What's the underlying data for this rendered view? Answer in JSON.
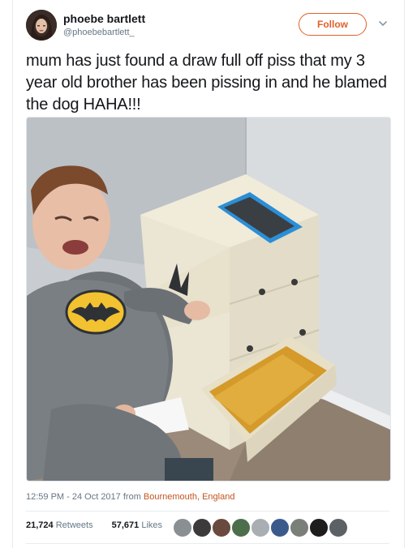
{
  "tweet": {
    "user": {
      "display_name": "phoebe bartlett",
      "handle": "@phoebebartlett_",
      "avatar_icon": "profile-avatar"
    },
    "follow_label": "Follow",
    "more_icon": "chevron-down-icon",
    "text": "mum has just found a draw full off piss that my 3 year old brother has been pissing in and he blamed the dog HAHA!!!",
    "media": {
      "icon": "photo-crying-boy-batman-costume-drawer"
    },
    "timestamp": "12:59 PM - 24 Oct 2017",
    "from_label": "from",
    "location": "Bournemouth, England",
    "stats": {
      "retweets_count": "21,724",
      "retweets_label": "Retweets",
      "likes_count": "57,671",
      "likes_label": "Likes"
    },
    "likers": [
      "liker-avatar-1",
      "liker-avatar-2",
      "liker-avatar-3",
      "liker-avatar-4",
      "liker-avatar-5",
      "liker-avatar-6",
      "liker-avatar-7",
      "liker-avatar-8",
      "liker-avatar-9"
    ]
  },
  "colors": {
    "accent": "#e0602a",
    "location": "#c2541e",
    "muted": "#657786",
    "text": "#14171a"
  }
}
